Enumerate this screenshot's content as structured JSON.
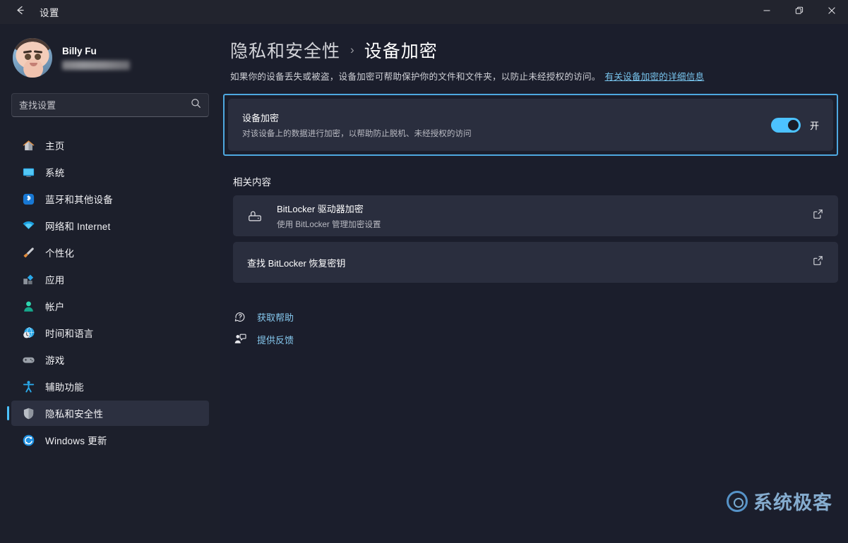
{
  "titlebar": {
    "back_icon": "back-arrow-icon",
    "title": "设置",
    "minimize_label": "最小化",
    "maximize_label": "还原",
    "close_label": "关闭"
  },
  "sidebar": {
    "account": {
      "name": "Billy Fu",
      "email_redacted": true,
      "avatar_alt": "用户头像"
    },
    "search": {
      "placeholder": "查找设置",
      "value": "",
      "icon": "search-icon"
    },
    "items": [
      {
        "label": "主页",
        "icon": "home-icon",
        "selected": false
      },
      {
        "label": "系统",
        "icon": "system-icon",
        "selected": false
      },
      {
        "label": "蓝牙和其他设备",
        "icon": "bluetooth-icon",
        "selected": false
      },
      {
        "label": "网络和 Internet",
        "icon": "wifi-icon",
        "selected": false
      },
      {
        "label": "个性化",
        "icon": "brush-icon",
        "selected": false
      },
      {
        "label": "应用",
        "icon": "apps-icon",
        "selected": false
      },
      {
        "label": "帐户",
        "icon": "account-icon",
        "selected": false
      },
      {
        "label": "时间和语言",
        "icon": "clock-globe-icon",
        "selected": false
      },
      {
        "label": "游戏",
        "icon": "gamepad-icon",
        "selected": false
      },
      {
        "label": "辅助功能",
        "icon": "accessibility-icon",
        "selected": false
      },
      {
        "label": "隐私和安全性",
        "icon": "shield-icon",
        "selected": true
      },
      {
        "label": "Windows 更新",
        "icon": "update-icon",
        "selected": false
      }
    ]
  },
  "main": {
    "breadcrumb": {
      "parent": "隐私和安全性",
      "separator": "›",
      "current": "设备加密"
    },
    "description": {
      "text": "如果你的设备丢失或被盗，设备加密可帮助保护你的文件和文件夹，以防止未经授权的访问。",
      "link": "有关设备加密的详细信息"
    },
    "encryption_card": {
      "title": "设备加密",
      "subtitle": "对该设备上的数据进行加密，以帮助防止脱机、未经授权的访问",
      "toggle_state": "开",
      "toggle_on": true,
      "focused": true
    },
    "related_section": {
      "heading": "相关内容",
      "cards": [
        {
          "title": "BitLocker 驱动器加密",
          "subtitle": "使用 BitLocker 管理加密设置",
          "icon": "bitlocker-drive-icon",
          "action_icon": "external-link-icon"
        },
        {
          "title": "查找 BitLocker 恢复密钥",
          "subtitle": "",
          "icon": "",
          "action_icon": "external-link-icon"
        }
      ]
    },
    "footer_links": [
      {
        "label": "获取帮助",
        "icon": "help-icon"
      },
      {
        "label": "提供反馈",
        "icon": "feedback-icon"
      }
    ]
  },
  "watermark": {
    "text": "系统极客",
    "logo_icon": "circle-swirl-logo-icon"
  },
  "colors": {
    "accent": "#4cc2ff",
    "focus_border": "#4ea8e0",
    "link": "#78c5ee",
    "card_bg": "#2a2e3e",
    "main_bg": "#1b1e2c",
    "sidebar_bg": "#1c1f2b",
    "titlebar_bg": "#22242e"
  }
}
